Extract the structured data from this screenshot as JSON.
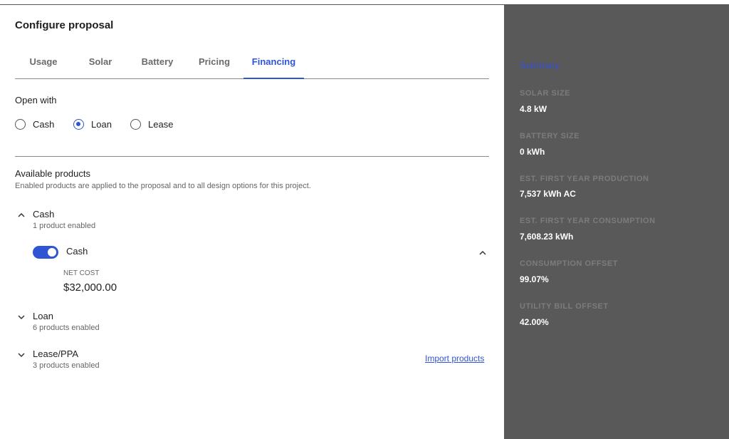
{
  "panel": {
    "title": "Configure proposal"
  },
  "tabs": [
    {
      "label": "Usage",
      "active": false
    },
    {
      "label": "Solar",
      "active": false
    },
    {
      "label": "Battery",
      "active": false
    },
    {
      "label": "Pricing",
      "active": false
    },
    {
      "label": "Financing",
      "active": true
    }
  ],
  "open_with": {
    "label": "Open with",
    "options": [
      {
        "label": "Cash",
        "checked": false
      },
      {
        "label": "Loan",
        "checked": true
      },
      {
        "label": "Lease",
        "checked": false
      }
    ]
  },
  "products": {
    "title": "Available products",
    "description": "Enabled products are applied to the proposal and to all design options for this project.",
    "groups": [
      {
        "name": "Cash",
        "sub": "1 product enabled",
        "expanded": true
      },
      {
        "name": "Loan",
        "sub": "6 products enabled",
        "expanded": false
      },
      {
        "name": "Lease/PPA",
        "sub": "3 products enabled",
        "expanded": false
      }
    ],
    "cash_item": {
      "name": "Cash",
      "enabled": true,
      "net_cost_label": "NET COST",
      "net_cost_value": "$32,000.00"
    },
    "import_label": "Import products"
  },
  "summary": {
    "title": "Summary",
    "items": [
      {
        "label": "SOLAR SIZE",
        "value": "4.8 kW"
      },
      {
        "label": "BATTERY SIZE",
        "value": "0 kWh"
      },
      {
        "label": "EST. FIRST YEAR PRODUCTION",
        "value": "7,537 kWh AC"
      },
      {
        "label": "EST. FIRST YEAR CONSUMPTION",
        "value": "7,608.23 kWh"
      },
      {
        "label": "CONSUMPTION OFFSET",
        "value": "99.07%"
      },
      {
        "label": "UTILITY BILL OFFSET",
        "value": "42.00%"
      }
    ]
  },
  "colors": {
    "accent": "#2f55d4",
    "summary_bg": "#595959",
    "summary_title": "#3550d8"
  },
  "icons": {
    "expanded": "chevron-up-icon",
    "collapsed": "chevron-down-icon"
  }
}
